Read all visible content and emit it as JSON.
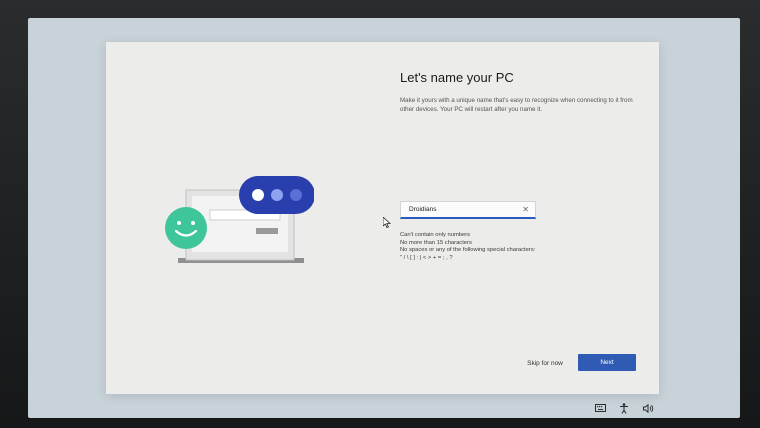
{
  "setup": {
    "title": "Let's name your PC",
    "description": "Make it yours with a unique name that's easy to recognize when connecting to it from other devices. Your PC will restart after you name it.",
    "pc_name_value": "Droidians",
    "rules": [
      "Can't contain only numbers",
      "No more than 15 characters",
      "No spaces or any of the following special characters:",
      "\" / \\ [ ] : | < > + = ; , ?"
    ],
    "skip_label": "Skip for now",
    "next_label": "Next"
  },
  "icons": {
    "clear": "close-icon",
    "cursor": "mouse-pointer-icon",
    "tray": [
      "keyboard-icon",
      "accessibility-icon",
      "volume-icon"
    ]
  },
  "colors": {
    "accent": "#2f5bb5",
    "card": "#ececea",
    "screen": "#c8d2d9",
    "bubble_blue": "#2a3fae",
    "face_green": "#3fc59a"
  }
}
